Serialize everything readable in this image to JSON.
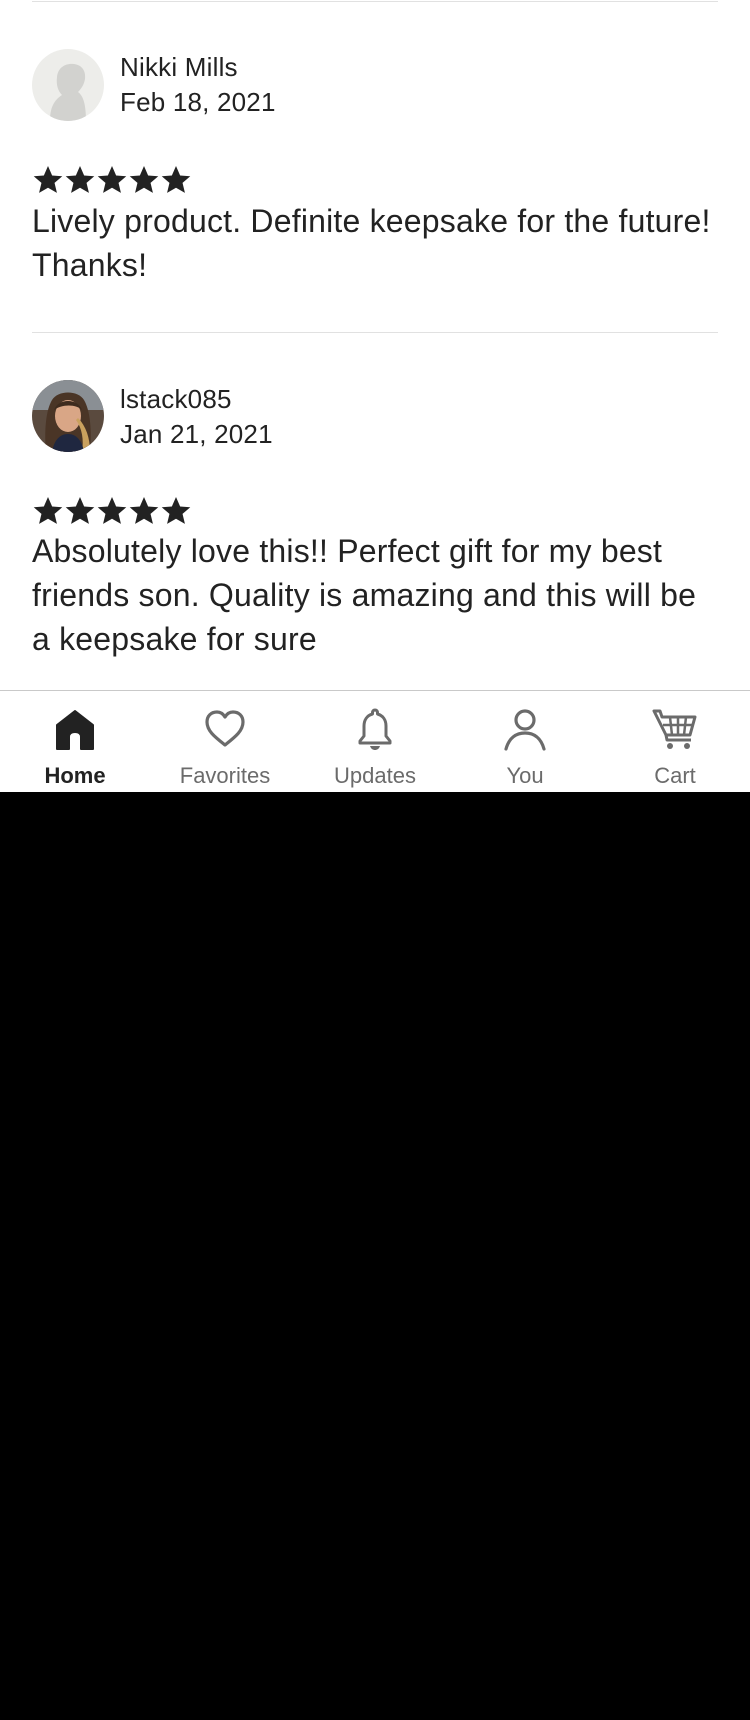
{
  "reviews": [
    {
      "reviewer": "Nikki Mills",
      "date": "Feb 18, 2021",
      "rating": 5,
      "text": "Lively product. Definite keepsake for the future! Thanks!",
      "avatar": "default-silhouette"
    },
    {
      "reviewer": "lstack085",
      "date": "Jan 21, 2021",
      "rating": 5,
      "text": "Absolutely love this!! Perfect gift for my best friends son. Quality is amazing and this will be a keepsake for sure",
      "avatar": "user-photo"
    }
  ],
  "nav": {
    "items": [
      {
        "label": "Home",
        "icon": "home-icon",
        "active": true
      },
      {
        "label": "Favorites",
        "icon": "heart-icon",
        "active": false
      },
      {
        "label": "Updates",
        "icon": "bell-icon",
        "active": false
      },
      {
        "label": "You",
        "icon": "user-icon",
        "active": false
      },
      {
        "label": "Cart",
        "icon": "cart-icon",
        "active": false
      }
    ]
  },
  "colors": {
    "text": "#222222",
    "muted": "#6b6b6b",
    "divider": "#e1e1e1",
    "star": "#222222"
  }
}
